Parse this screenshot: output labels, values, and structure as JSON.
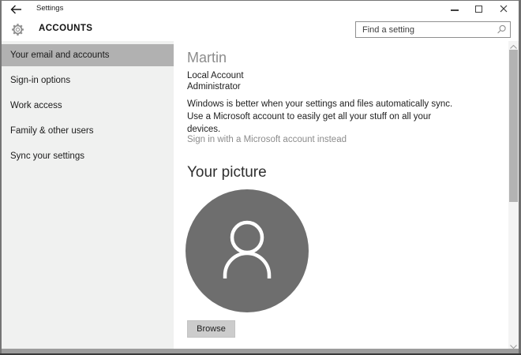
{
  "window": {
    "title": "Settings"
  },
  "header": {
    "title": "ACCOUNTS",
    "search_placeholder": "Find a setting"
  },
  "sidebar": {
    "items": [
      {
        "label": "Your email and accounts",
        "selected": true
      },
      {
        "label": "Sign-in options",
        "selected": false
      },
      {
        "label": "Work access",
        "selected": false
      },
      {
        "label": "Family & other users",
        "selected": false
      },
      {
        "label": "Sync your settings",
        "selected": false
      }
    ]
  },
  "main": {
    "account": {
      "name": "Martin",
      "type": "Local Account",
      "role": "Administrator"
    },
    "sync_message_lines": [
      "Windows is better when your settings and files automatically sync.",
      "Use a Microsoft account to easily get all your stuff on all your",
      "devices."
    ],
    "microsoft_link": "Sign in with a Microsoft account instead",
    "picture_heading": "Your picture",
    "browse_label": "Browse"
  },
  "icons": {
    "back": "left-arrow",
    "gear": "settings-gear",
    "search": "magnifier",
    "minimize": "horizontal-bar",
    "maximize": "square-outline",
    "close": "x-cross",
    "avatar": "person-silhouette",
    "scroll_up": "chevron-up",
    "scroll_down": "chevron-down"
  },
  "colors": {
    "selected_item_bg": "#b1b1b1",
    "sidebar_bg": "#f0f1f0",
    "avatar_bg": "#6e6e6e",
    "window_border": "#757575",
    "bottom_border": "#9c9c9c"
  }
}
